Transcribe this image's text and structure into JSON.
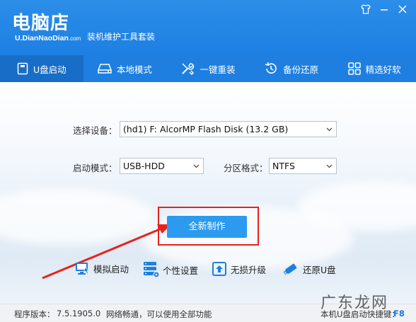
{
  "header": {
    "logo": "电脑店",
    "logo_domain": "U.DianNaoDian",
    "logo_tld": ".com",
    "subtitle": "装机维护工具套装"
  },
  "window_controls": [
    "shirt-icon",
    "minimize-icon",
    "close-icon"
  ],
  "nav": {
    "items": [
      {
        "label": "U盘启动",
        "icon": "usb-icon",
        "active": true
      },
      {
        "label": "本地模式",
        "icon": "hard-drive-icon",
        "active": false
      },
      {
        "label": "一键重装",
        "icon": "tools-icon",
        "active": false
      },
      {
        "label": "备份还原",
        "icon": "restore-icon",
        "active": false
      },
      {
        "label": "精选好软",
        "icon": "apps-grid-icon",
        "active": false
      }
    ]
  },
  "form": {
    "device_label": "选择设备：",
    "device_value": "(hd1) F: AlcorMP Flash Disk (13.2 GB)",
    "boot_mode_label": "启动模式：",
    "boot_mode_value": "USB-HDD",
    "partition_label": "分区格式：",
    "partition_value": "NTFS"
  },
  "actions": {
    "make_label": "全新制作"
  },
  "tools": [
    {
      "label": "模拟启动",
      "icon": "simulate-boot-icon"
    },
    {
      "label": "个性设置",
      "icon": "server-settings-icon"
    },
    {
      "label": "无损升级",
      "icon": "upgrade-icon"
    },
    {
      "label": "还原U盘",
      "icon": "usb-restore-icon"
    }
  ],
  "status": {
    "version_label": "程序版本：",
    "version_value": "7.5.1905.0",
    "network": "网络畅通，可以使用全部功能",
    "hotkey_label": "本机U盘启动快捷键：",
    "hotkey_value": "F8"
  },
  "watermark": "广东龙网",
  "colors": {
    "brand_blue": "#1e7fe0",
    "button_blue": "#2b9aef",
    "annotation_red": "#e8211c"
  }
}
